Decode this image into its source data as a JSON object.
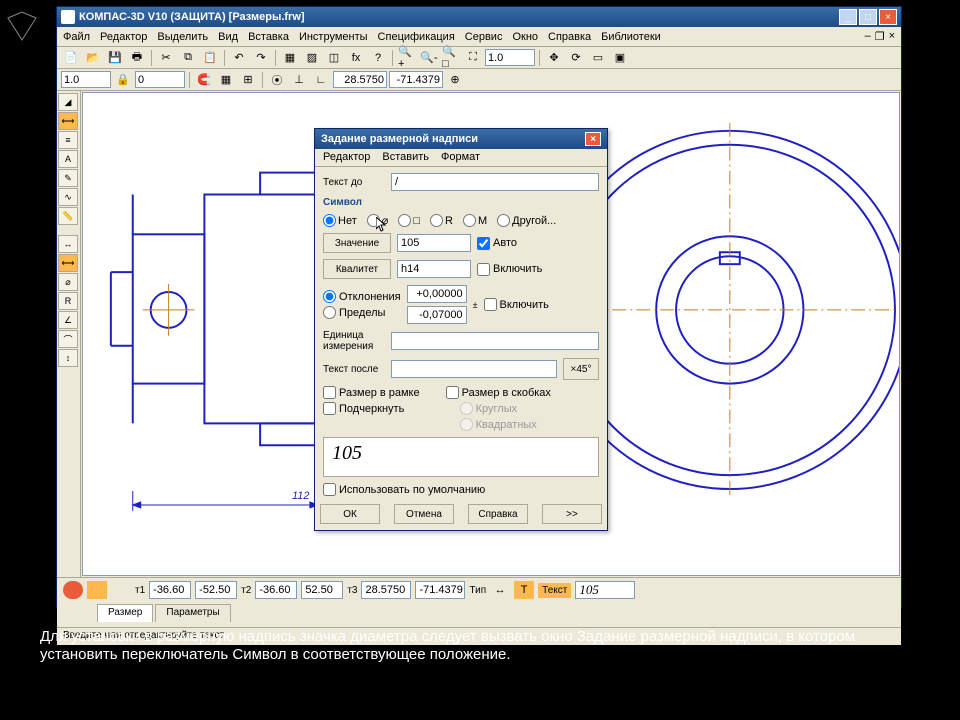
{
  "app": {
    "title": "КОМПАС-3D V10 (ЗАЩИТА)  [Размеры.frw]",
    "menu": [
      "Файл",
      "Редактор",
      "Выделить",
      "Вид",
      "Вставка",
      "Инструменты",
      "Спецификация",
      "Сервис",
      "Окно",
      "Справка",
      "Библиотеки"
    ],
    "statusbar": "Введите или отредактируйте текст"
  },
  "toolbar2": {
    "scale": "1.0",
    "angle": "0",
    "coord_x": "28.5750",
    "coord_y": "-71.4379",
    "zoom": "1.0"
  },
  "drawing": {
    "dim_text": "112"
  },
  "prop": {
    "x1": "-36.60",
    "y1": "-52.50",
    "x2": "-36.60",
    "y2": "52.50",
    "px": "28.5750",
    "py": "-71.4379",
    "tx_label": "Текст",
    "tx_value": "105",
    "labels": {
      "t1": "т1",
      "t2": "т2",
      "t3": "т3",
      "type": "Тип"
    },
    "tabs": [
      "Размер",
      "Параметры"
    ]
  },
  "dialog": {
    "title": "Задание размерной надписи",
    "menu": [
      "Редактор",
      "Вставить",
      "Формат"
    ],
    "text_before_label": "Текст до",
    "text_before_value": "/",
    "symbol_group": "Символ",
    "symbols": {
      "none": "Нет",
      "diameter": "⌀",
      "square": "□",
      "radius": "R",
      "metric": "M",
      "other": "Другой..."
    },
    "value_btn": "Значение",
    "value_val": "105",
    "auto": "Авто",
    "kvalitet_btn": "Квалитет",
    "kvalitet_val": "h14",
    "include1": "Включить",
    "deviations": "Отклонения",
    "limits": "Пределы",
    "dev_upper": "+0,00000",
    "dev_lower": "-0,07000",
    "include2": "Включить",
    "unit_label": "Единица измерения",
    "text_after_label": "Текст после",
    "angle_btn": "×45°",
    "frame": "Размер в рамке",
    "underline": "Подчеркнуть",
    "brackets": "Размер в скобках",
    "round": "Круглых",
    "square_br": "Квадратных",
    "preview": "105",
    "use_default": "Использовать по умолчанию",
    "ok": "ОК",
    "cancel": "Отмена",
    "help": "Справка",
    "more": ">>"
  },
  "subtitle": "Для установки в размерную надпись значка диаметра следует вызвать окно Задание размерной надписи, в котором установить переключатель Символ в соответствующее положение."
}
